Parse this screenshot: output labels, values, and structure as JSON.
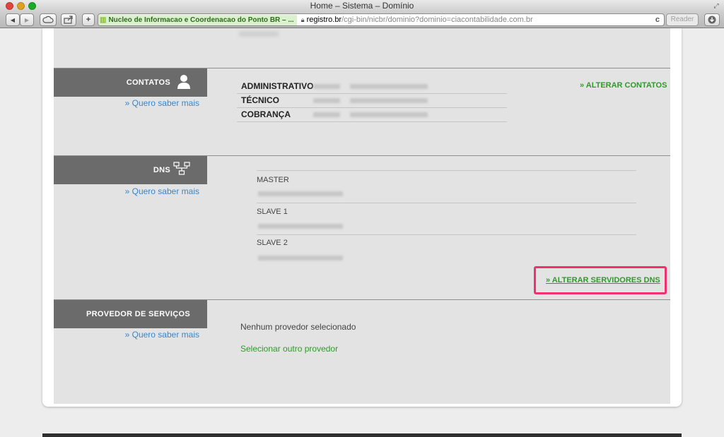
{
  "browser": {
    "window_title": "Home – Sistema – Domínio",
    "site_badge": "Nucleo de Informacao e Coordenacao do Ponto BR – ...",
    "url_host": "registro.br",
    "url_path": "/cgi-bin/nicbr/dominio?dominio=ciacontabilidade.com.br",
    "reader_label": "Reader",
    "back_icon": "◀",
    "forward_icon": "▶",
    "add_icon": "+",
    "reload_icon": "c"
  },
  "contatos": {
    "title": "CONTATOS",
    "more_link": "» Quero saber mais",
    "rows": [
      {
        "label": "ADMINISTRATIVO"
      },
      {
        "label": "TÉCNICO"
      },
      {
        "label": "COBRANÇA"
      }
    ],
    "action": "» ALTERAR CONTATOS"
  },
  "dns": {
    "title": "DNS",
    "more_link": "» Quero saber mais",
    "servers": [
      {
        "label": "MASTER"
      },
      {
        "label": "SLAVE 1"
      },
      {
        "label": "SLAVE 2"
      }
    ],
    "action": "» ALTERAR SERVIDORES DNS",
    "highlight_color": "#f0306f"
  },
  "provedor": {
    "title": "PROVEDOR DE SERVIÇOS",
    "more_link": "» Quero saber mais",
    "status": "Nenhum provedor selecionado",
    "select_link": "Selecionar outro provedor"
  },
  "colors": {
    "section_header_bg": "#6b6b6b",
    "link_blue": "#3a86c8",
    "link_green": "#2e9a2a"
  }
}
